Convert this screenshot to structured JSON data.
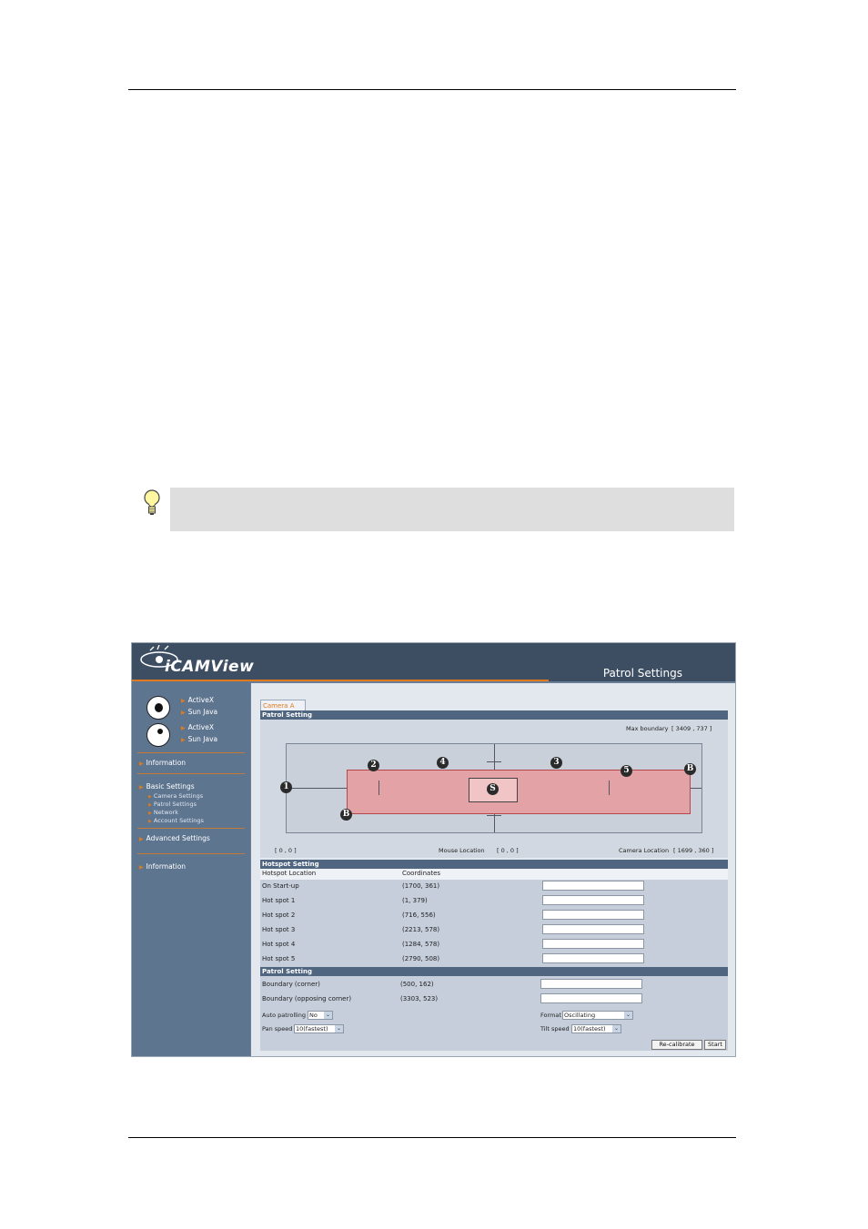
{
  "screenshot": {
    "app_logo": "iCAMView",
    "page_title": "Patrol Settings",
    "sidebar": {
      "group1": [
        {
          "label": "ActiveX"
        },
        {
          "label": "Sun Java"
        }
      ],
      "group2": [
        {
          "label": "ActiveX"
        },
        {
          "label": "Sun Java"
        }
      ],
      "menu": [
        {
          "label": "Information"
        },
        {
          "label": "Basic Settings",
          "children": [
            "Camera Settings",
            "Patrol Settings",
            "Network",
            "Account Settings"
          ]
        },
        {
          "label": "Advanced Settings"
        },
        {
          "label": "Information"
        }
      ]
    },
    "tab_label": "Camera A",
    "patrol_section_title": "Patrol Setting",
    "max_boundary_label": "Max boundary",
    "max_boundary_value": "[ 3409 , 737 ]",
    "origin_label": "[ 0 , 0 ]",
    "mouse_location_label": "Mouse Location",
    "mouse_location_value": "[ 0 , 0 ]",
    "camera_location_label": "Camera Location",
    "camera_location_value": "[ 1699 , 360 ]",
    "markers": {
      "start": "S",
      "boundary": "B",
      "hotspots": [
        "1",
        "2",
        "3",
        "4",
        "5"
      ]
    },
    "hotspot_section_title": "Hotspot Setting",
    "hotspot_col_location": "Hotspot Location",
    "hotspot_col_coordinates": "Coordinates",
    "hotspots": [
      {
        "label": "On Start-up",
        "coords": "(1700, 361)"
      },
      {
        "label": "Hot spot 1",
        "coords": "(1, 379)"
      },
      {
        "label": "Hot spot 2",
        "coords": "(716, 556)"
      },
      {
        "label": "Hot spot 3",
        "coords": "(2213, 578)"
      },
      {
        "label": "Hot spot 4",
        "coords": "(1284, 578)"
      },
      {
        "label": "Hot spot 5",
        "coords": "(2790, 508)"
      }
    ],
    "patrol_setting_title": "Patrol Setting",
    "boundary_rows": [
      {
        "label": "Boundary (corner)",
        "coords": "(500, 162)"
      },
      {
        "label": "Boundary (opposing corner)",
        "coords": "(3303, 523)"
      }
    ],
    "auto_patrolling_label": "Auto patrolling",
    "auto_patrolling_value": "No",
    "format_label": "Format",
    "format_value": "Oscillating",
    "pan_speed_label": "Pan speed",
    "pan_speed_value": "10(fastest)",
    "tilt_speed_label": "Tilt speed",
    "tilt_speed_value": "10(fastest)",
    "recalibrate_button": "Re-calibrate",
    "start_button": "Start",
    "dropdown_glyph": "⌄"
  },
  "colors": {
    "accent": "#e07a1c",
    "header": "#3d4e63",
    "sidebar": "#5e7590",
    "bar": "#4f6580",
    "boundary_fill": "#e3a3a6"
  }
}
